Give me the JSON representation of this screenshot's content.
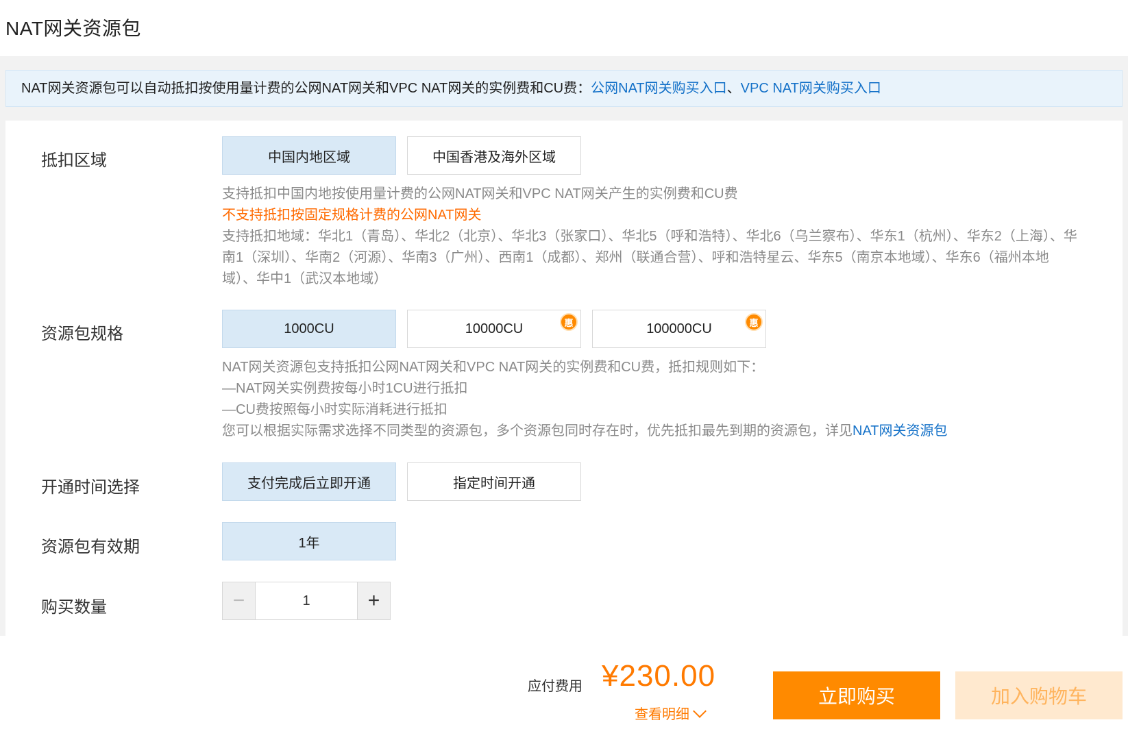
{
  "page": {
    "title": "NAT网关资源包"
  },
  "notice": {
    "text": "NAT网关资源包可以自动抵扣按使用量计费的公网NAT网关和VPC NAT网关的实例费和CU费：",
    "link1": "公网NAT网关购买入口",
    "separator": "、",
    "link2": "VPC NAT网关购买入口"
  },
  "region": {
    "label": "抵扣区域",
    "options": [
      "中国内地区域",
      "中国香港及海外区域"
    ],
    "selected": "中国内地区域",
    "desc_line1": "支持抵扣中国内地按使用量计费的公网NAT网关和VPC NAT网关产生的实例费和CU费",
    "desc_warn": "不支持抵扣按固定规格计费的公网NAT网关",
    "desc_regions": "支持抵扣地域：华北1（青岛）、华北2（北京）、华北3（张家口）、华北5（呼和浩特）、华北6（乌兰察布）、华东1（杭州）、华东2（上海）、华南1（深圳）、华南2（河源）、华南3（广州）、西南1（成都）、郑州（联通合营）、呼和浩特星云、华东5（南京本地域）、华东6（福州本地域）、华中1（武汉本地域）"
  },
  "spec": {
    "label": "资源包规格",
    "options": [
      "1000CU",
      "10000CU",
      "100000CU"
    ],
    "selected": "1000CU",
    "badge": "惠",
    "desc_line1": "NAT网关资源包支持抵扣公网NAT网关和VPC NAT网关的实例费和CU费，抵扣规则如下：",
    "desc_line2": "—NAT网关实例费按每小时1CU进行抵扣",
    "desc_line3": "—CU费按照每小时实际消耗进行抵扣",
    "desc_line4": "您可以根据实际需求选择不同类型的资源包，多个资源包同时存在时，优先抵扣最先到期的资源包，详见",
    "desc_link": "NAT网关资源包"
  },
  "activation": {
    "label": "开通时间选择",
    "options": [
      "支付完成后立即开通",
      "指定时间开通"
    ],
    "selected": "支付完成后立即开通"
  },
  "validity": {
    "label": "资源包有效期",
    "options": [
      "1年"
    ],
    "selected": "1年"
  },
  "quantity": {
    "label": "购买数量",
    "value": "1",
    "minus": "−",
    "plus": "+"
  },
  "footer": {
    "fee_label": "应付费用",
    "fee_amount": "¥230.00",
    "detail_label": "查看明细",
    "buy_label": "立即购买",
    "cart_label": "加入购物车"
  },
  "colors": {
    "accent": "#ff8a00",
    "link": "#1471c8",
    "selected_bg": "#d9e9f6",
    "warn": "#ff6a00"
  }
}
